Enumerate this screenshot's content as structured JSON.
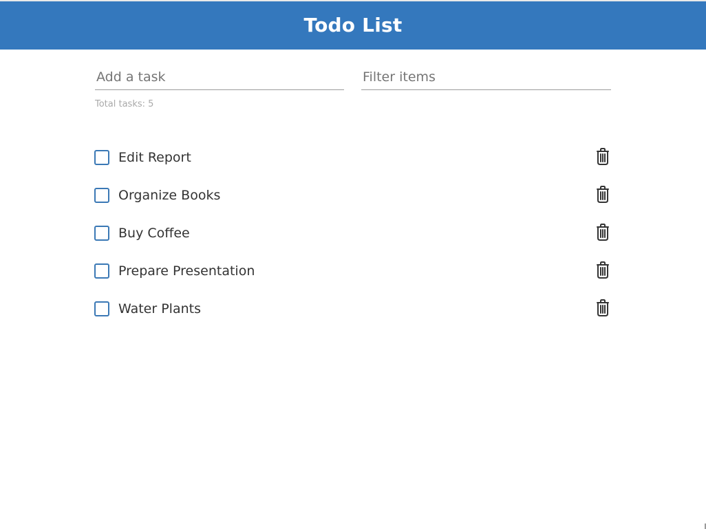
{
  "header": {
    "title": "Todo List"
  },
  "task_input": {
    "placeholder": "Add a task",
    "value": ""
  },
  "filter_input": {
    "placeholder": "Filter items",
    "value": ""
  },
  "summary": {
    "total_text": "Total tasks: 5"
  },
  "todos": [
    {
      "text": "Edit Report",
      "checked": false,
      "delete_icon": "trash-icon"
    },
    {
      "text": "Organize Books",
      "checked": false,
      "delete_icon": "trash-icon"
    },
    {
      "text": "Buy Coffee",
      "checked": false,
      "delete_icon": "trash-icon"
    },
    {
      "text": "Prepare Presentation",
      "checked": false,
      "delete_icon": "trash-icon"
    },
    {
      "text": "Water Plants",
      "checked": false,
      "delete_icon": "trash-icon"
    }
  ],
  "colors": {
    "header_background": "#3478bd",
    "header_text": "#ffffff",
    "checkbox_border": "#3a78b5",
    "task_text": "#333333",
    "summary_text": "#a9a9a9"
  }
}
